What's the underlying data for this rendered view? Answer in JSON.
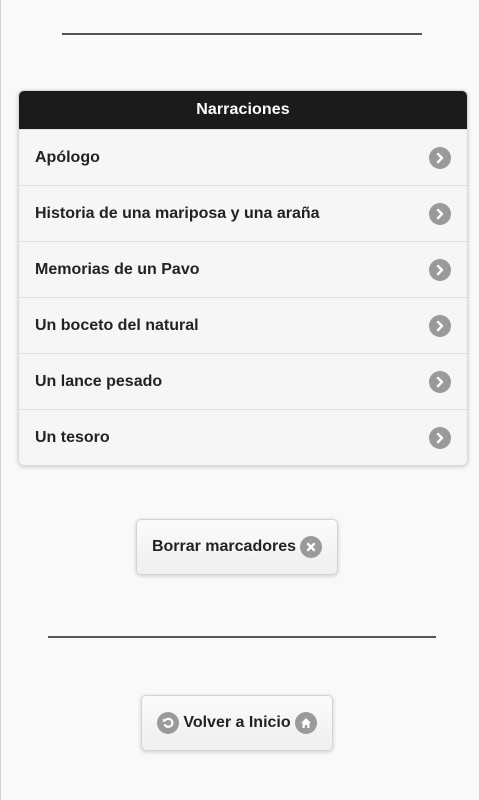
{
  "list": {
    "header": "Narraciones",
    "items": [
      {
        "label": "Apólogo",
        "icon": "chevron-right-icon"
      },
      {
        "label": "Historia de una mariposa y una araña",
        "icon": "chevron-right-icon"
      },
      {
        "label": "Memorias de un Pavo",
        "icon": "chevron-right-icon"
      },
      {
        "label": "Un boceto del natural",
        "icon": "chevron-right-icon"
      },
      {
        "label": "Un lance pesado",
        "icon": "chevron-right-icon"
      },
      {
        "label": "Un tesoro",
        "icon": "chevron-right-icon"
      }
    ]
  },
  "buttons": {
    "clear_bookmarks": {
      "label": "Borrar marcadores",
      "icon": "close-icon"
    },
    "home": {
      "label": "Volver a Inicio",
      "left_icon": "back-arrow-icon",
      "right_icon": "home-icon"
    }
  },
  "colors": {
    "header_bg": "#1b1b1b",
    "header_text": "#ffffff",
    "icon_bg": "#9a9a9a",
    "page_bg": "#f9f9f9"
  }
}
